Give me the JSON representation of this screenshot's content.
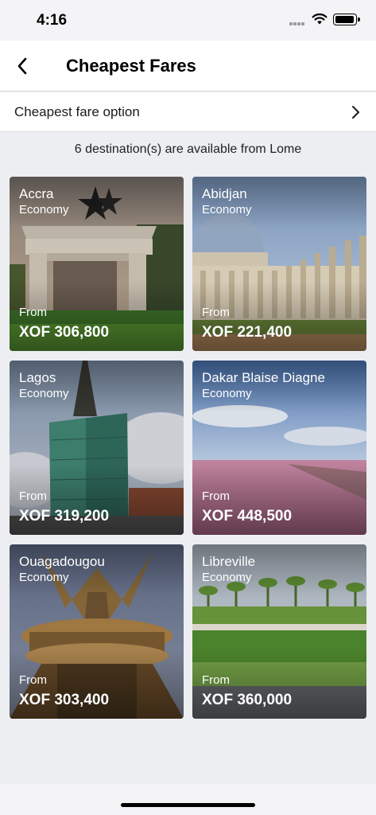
{
  "status_bar": {
    "time": "4:16"
  },
  "header": {
    "title": "Cheapest Fares",
    "back_icon": "chevron-left-icon"
  },
  "option_row": {
    "label": "Cheapest fare option",
    "icon": "chevron-right-icon"
  },
  "availability_text": "6 destination(s) are available from Lome",
  "cards": [
    {
      "city": "Accra",
      "cabin": "Economy",
      "from_label": "From",
      "price": "XOF 306,800"
    },
    {
      "city": "Abidjan",
      "cabin": "Economy",
      "from_label": "From",
      "price": "XOF 221,400"
    },
    {
      "city": "Lagos",
      "cabin": "Economy",
      "from_label": "From",
      "price": "XOF 319,200"
    },
    {
      "city": "Dakar Blaise Diagne",
      "cabin": "Economy",
      "from_label": "From",
      "price": "XOF 448,500"
    },
    {
      "city": "Ouagadougou",
      "cabin": "Economy",
      "from_label": "From",
      "price": "XOF 303,400"
    },
    {
      "city": "Libreville",
      "cabin": "Economy",
      "from_label": "From",
      "price": "XOF 360,000"
    }
  ]
}
